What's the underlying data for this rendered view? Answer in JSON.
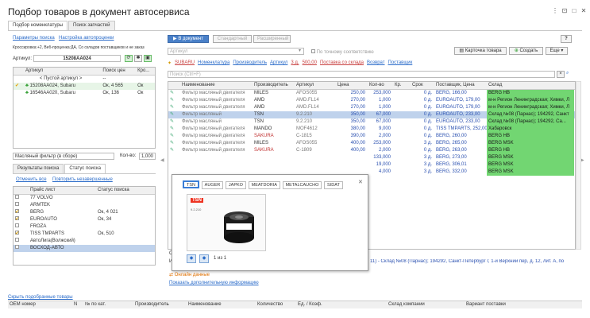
{
  "window": {
    "title": "Подбор товаров в документ автосервиса",
    "btn_more": "⋮",
    "btn_restore": "⊡",
    "btn_max": "□",
    "btn_close": "✕"
  },
  "tabs": [
    "Подбор номенклатуры",
    "Поиск запчастей"
  ],
  "left": {
    "link_params": "Параметры поиска",
    "link_setup": "Настройка автопроценки",
    "info": "Кроссировка:+2, Веб-проценка:ДА, Со складов поставщиков и не заказ",
    "article_label": "Артикул:",
    "article_value": "15208AA024",
    "grid_headers": [
      "Артикул",
      "Поиск цен",
      "Кро..."
    ],
    "rows": [
      {
        "a": "< Пустой артикул >",
        "b": "--",
        "c": ""
      },
      {
        "a": "15208AA024, Subaru",
        "b": "Ок, 4 565",
        "c": "Ок"
      },
      {
        "a": "16546AA020, Subaru",
        "b": "Ок, 136",
        "c": "Ок"
      }
    ],
    "name_value": "Масляный фильтр (в сборе)",
    "qty_label": "Кол-во:",
    "qty_value": "1,000",
    "subtabs": [
      "Результаты поиска",
      "Статус поиска"
    ],
    "link_cancel": "Отменить все",
    "link_repeat": "Повторить незавершенные",
    "price_headers": [
      "Прайс лист",
      "Статус поиска"
    ],
    "prices": [
      {
        "name": "77 VOLVO",
        "status": "",
        "checked": false
      },
      {
        "name": "ARMTEK",
        "status": "",
        "checked": false
      },
      {
        "name": "BERG",
        "status": "Ок, 4 021",
        "checked": true
      },
      {
        "name": "EUROAUTO",
        "status": "Ок, 34",
        "checked": true
      },
      {
        "name": "FROZA",
        "status": "",
        "checked": false
      },
      {
        "name": "TISS TMPARTS",
        "status": "Ок, 510",
        "checked": true
      },
      {
        "name": "АвтоЛига(Волжский)",
        "status": "",
        "checked": false
      },
      {
        "name": "ВОСХОД-АВТО",
        "status": "",
        "checked": false
      }
    ],
    "link_hide": "Скрыть подобранные товары"
  },
  "right": {
    "btn_doc": "В документ",
    "btn_std": "Стандартный",
    "btn_ext": "Расширенный",
    "article_placeholder": "Артикул",
    "exact_label": "По точному соответствию",
    "btn_card": "Карточка товара",
    "btn_create": "Создать",
    "btn_more": "Еще",
    "help": "?",
    "filter_items": [
      "SUBARU",
      "Номенклатура",
      "Производитель",
      "Артикул",
      "3 д.",
      "500,00",
      "Поставка со склада",
      "Возврат",
      "Поставщик"
    ],
    "search_placeholder": "Поиск (Ctrl+F)",
    "headers": [
      "Наименование",
      "Производитель",
      "Артикул",
      "Цена",
      "Кол-во",
      "Кр.",
      "Срок",
      "Поставщик, Цена",
      "Склад"
    ],
    "rows": [
      {
        "n": "Фильтр масляный двигателя",
        "m": "MILES",
        "a": "AFOS055",
        "p": "250,00",
        "q": "253,000",
        "k": "",
        "s": "0 д.",
        "v": "BERG, 166,00",
        "w": "BERG HB",
        "g": true
      },
      {
        "n": "Фильтр масляный двигателя",
        "m": "AMD",
        "a": "AMD.FL14",
        "p": "270,00",
        "q": "1,000",
        "k": "",
        "s": "0 д.",
        "v": "EUROAUTO, 179,00",
        "w": "м-н Регион Ленинградская; Химки, Л",
        "g": true
      },
      {
        "n": "Фильтр масляный двигателя",
        "m": "AMD",
        "a": "AMD.FL14",
        "p": "270,00",
        "q": "1,000",
        "k": "",
        "s": "0 д.",
        "v": "EUROAUTO, 179,00",
        "w": "м-н Регион Ленинградская; Химки, Л",
        "g": true
      },
      {
        "n": "Фильтр масляный",
        "m": "TSN",
        "a": "9.2.210",
        "p": "350,00",
        "q": "67,000",
        "k": "",
        "s": "0 д.",
        "v": "EUROAUTO, 233,00",
        "w": "Склад №08 (Парнас); 194292, Санкт",
        "g": true,
        "hl": true
      },
      {
        "n": "Фильтр масляный",
        "m": "TSN",
        "a": "9.2.210",
        "p": "350,00",
        "q": "67,000",
        "k": "",
        "s": "0 д.",
        "v": "EUROAUTO, 233,00",
        "w": "Склад №08 (Парнас); 194292, Са...",
        "g": true
      },
      {
        "n": "Фильтр масляный двигателя",
        "m": "MANDO",
        "a": "MOF4612",
        "p": "380,00",
        "q": "9,000",
        "k": "",
        "s": "0 д.",
        "v": "TISS TMPARTS, 252,00",
        "w": "Хабаровск",
        "g": true
      },
      {
        "n": "Фильтр масляный двигателя",
        "m": "SAKURA",
        "a": "C-1815",
        "p": "390,00",
        "q": "2,000",
        "k": "",
        "s": "0 д.",
        "v": "BERG, 260,00",
        "w": "BERG HB",
        "g": true,
        "rm": true
      },
      {
        "n": "Фильтр масляный двигателя",
        "m": "MILES",
        "a": "AFOS055",
        "p": "400,00",
        "q": "253,000",
        "k": "",
        "s": "3 д.",
        "v": "BERG, 265,00",
        "w": "BERG MSK",
        "g": true
      },
      {
        "n": "Фильтр масляный двигателя",
        "m": "SAKURA",
        "a": "C-1809",
        "p": "400,00",
        "q": "2,000",
        "k": "",
        "s": "0 д.",
        "v": "BERG, 263,00",
        "w": "BERG HB",
        "g": true,
        "rm": true
      },
      {
        "n": "",
        "m": "",
        "a": "",
        "p": "",
        "q": "133,000",
        "k": "",
        "s": "3 д.",
        "v": "BERG, 273,00",
        "w": "BERG MSK",
        "g": true
      },
      {
        "n": "",
        "m": "",
        "a": "",
        "p": "",
        "q": "19,000",
        "k": "",
        "s": "3 д.",
        "v": "BERG, 306,01",
        "w": "BERG MSK",
        "g": true
      },
      {
        "n": "",
        "m": "",
        "a": "",
        "p": "",
        "q": "4,000",
        "k": "",
        "s": "3 д.",
        "v": "BERG, 332,00",
        "w": "BERG MSK",
        "g": true
      }
    ],
    "detail_prefix": "Ок",
    "detail_label": "Ин",
    "detail_text": "11) - Склад №08 (Парнас); 194292, Санкт-Петербург г, 1-й Верхний пер, д. 12, лит. А, по",
    "online_label": "Онлайн данные",
    "link_more": "Показать дополнительную информацию"
  },
  "popup": {
    "tabs": [
      "TSN",
      "AUGER",
      "JAPKO",
      "MEATDORIA",
      "METALCAUCHO",
      "SIDAT"
    ],
    "close": "✕",
    "brand": "TSN",
    "code": "9.2.210",
    "pager": "1 из 1"
  },
  "bottom": {
    "headers": [
      "OEM номер",
      "N",
      "№ по кат.",
      "Производитель",
      "Наименование",
      "Количество",
      "Ед. / Коэф.",
      "Склад компании",
      "Вариант поставки"
    ]
  }
}
